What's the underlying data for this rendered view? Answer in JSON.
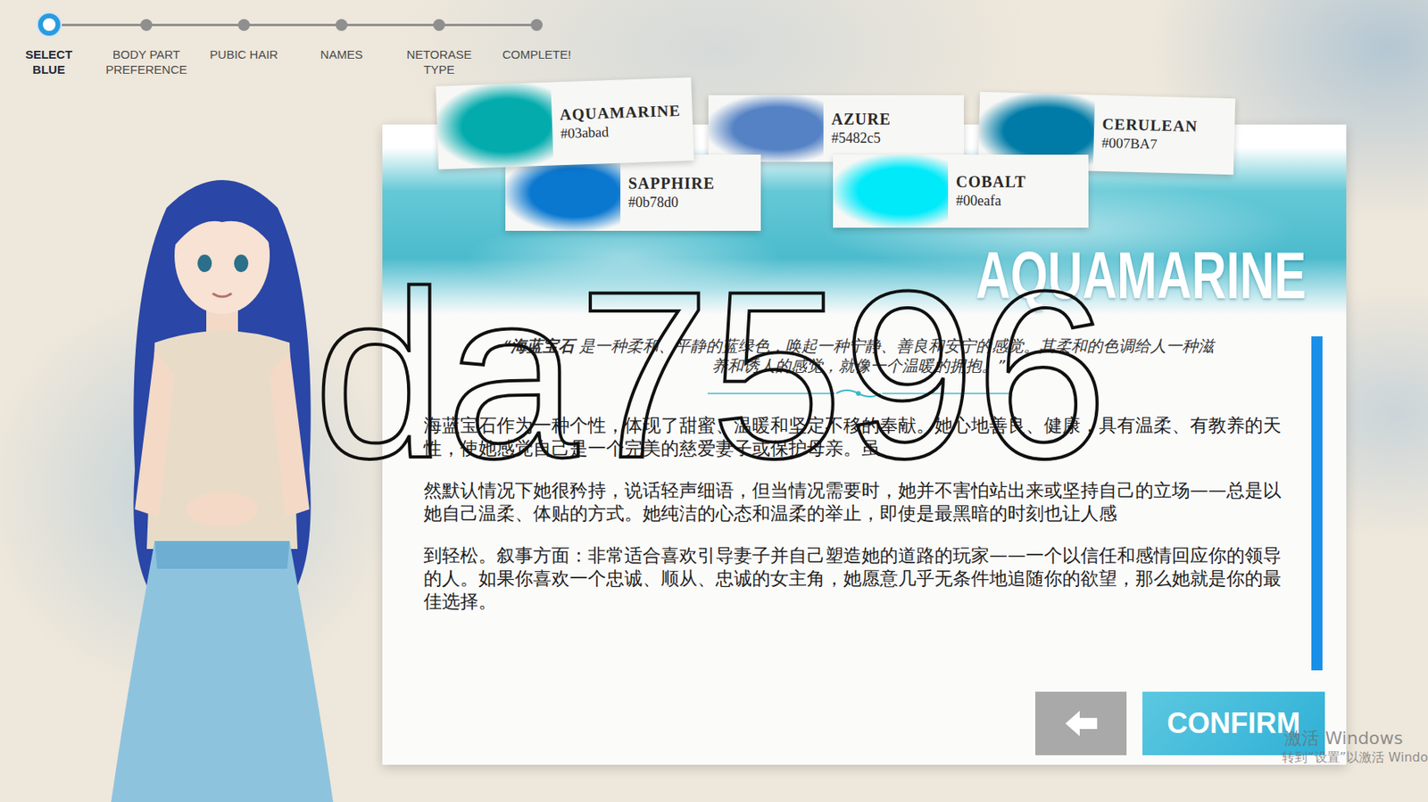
{
  "steps": [
    {
      "label": "SELECT\nBLUE",
      "selected": true
    },
    {
      "label": "BODY PART\nPREFERENCE",
      "selected": false
    },
    {
      "label": "PUBIC HAIR",
      "selected": false
    },
    {
      "label": "NAMES",
      "selected": false
    },
    {
      "label": "NETORASE\nTYPE",
      "selected": false
    },
    {
      "label": "COMPLETE!",
      "selected": false
    }
  ],
  "swatches": [
    {
      "name": "AQUAMARINE",
      "hex": "#03abad",
      "color": "#03abad",
      "selected": true
    },
    {
      "name": "AZURE",
      "hex": "#5482c5",
      "color": "#5482c5",
      "selected": false
    },
    {
      "name": "CERULEAN",
      "hex": "#007BA7",
      "color": "#007BA7",
      "selected": false
    },
    {
      "name": "SAPPHIRE",
      "hex": "#0b78d0",
      "color": "#0b78d0",
      "selected": false
    },
    {
      "name": "COBALT",
      "hex": "#00eafa",
      "color": "#00eafa",
      "selected": false
    }
  ],
  "detail": {
    "title": "AQUAMARINE",
    "quote_open": "“",
    "quote_name": "海蓝宝石",
    "quote_text": " 是一种柔和、平静的蓝绿色，唤起一种宁静、善良和安宁的感觉。其柔和的色调给人一种滋养和诱人的感觉，就像一个温暖的拥抱。”",
    "paragraphs": [
      "海蓝宝石作为一种个性，体现了甜蜜、温暖和坚定不移的奉献。她心地善良、健康，具有温柔、有教养的天性，使她感觉自己是一个完美的慈爱妻子或保护母亲。虽",
      "然默认情况下她很矜持，说话轻声细语，但当情况需要时，她并不害怕站出来或坚持自己的立场——总是以她自己温柔、体贴的方式。她纯洁的心态和温柔的举止，即使是最黑暗的时刻也让人感",
      "到轻松。叙事方面：非常适合喜欢引导妻子并自己塑造她的道路的玩家——一个以信任和感情回应你的领导的人。如果你喜欢一个忠诚、顺从、忠诚的女主角，她愿意几乎无条件地追随你的欲望，那么她就是你的最佳选择。"
    ]
  },
  "buttons": {
    "confirm": "CONFIRM"
  },
  "watermark": "da7596",
  "os_watermark": [
    "激活 Windows",
    "转到“设置”以激活 Windo"
  ]
}
